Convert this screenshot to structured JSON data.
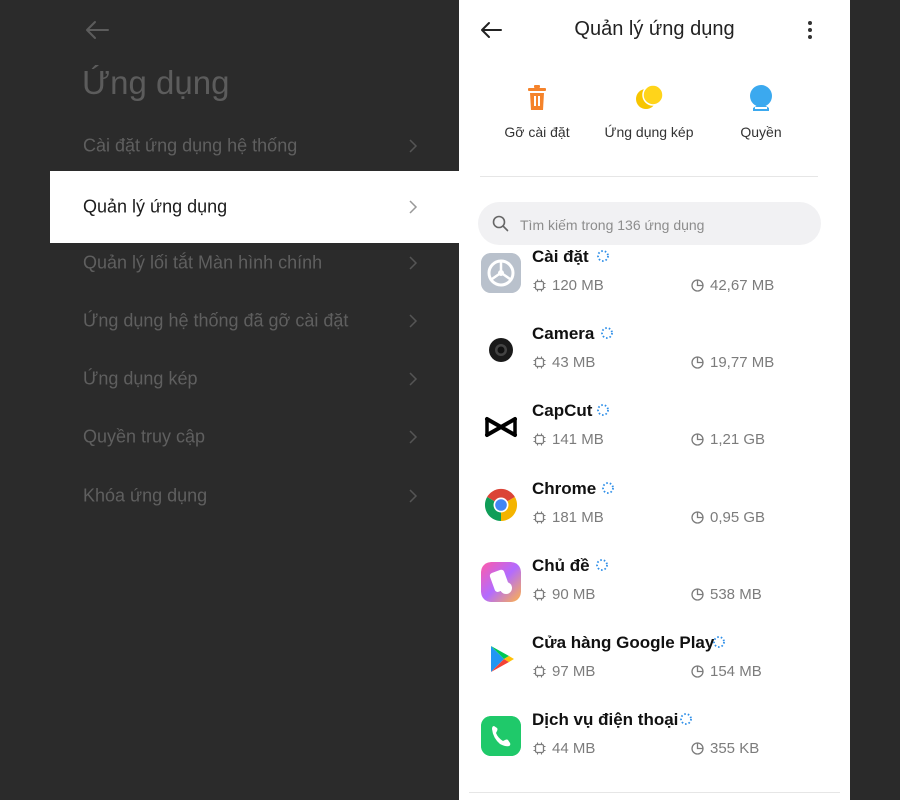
{
  "left": {
    "title": "Ứng dụng",
    "items": [
      {
        "label": "Cài đặt ứng dụng hệ thống"
      },
      {
        "label": "Quản lý ứng dụng"
      },
      {
        "label": "Quản lý lối tắt Màn hình chính"
      },
      {
        "label": "Ứng dụng hệ thống đã gỡ cài đặt"
      },
      {
        "label": "Ứng dụng kép"
      },
      {
        "label": "Quyền truy cập"
      },
      {
        "label": "Khóa ứng dụng"
      }
    ]
  },
  "right": {
    "title": "Quản lý ứng dụng",
    "quick_actions": [
      {
        "label": "Gỡ cài đặt",
        "icon": "trash-icon",
        "color": "#F5832B"
      },
      {
        "label": "Ứng dụng kép",
        "icon": "dual-circles-icon",
        "color": "#F7C500"
      },
      {
        "label": "Quyền",
        "icon": "permission-icon",
        "color": "#3BA9EF"
      }
    ],
    "search": {
      "placeholder": "Tìm kiếm trong 136 ứng dụng"
    },
    "apps": [
      {
        "name": "Cài đặt",
        "memory": "120 MB",
        "storage": "42,67 MB",
        "icon": "settings-app-icon"
      },
      {
        "name": "Camera",
        "memory": "43 MB",
        "storage": "19,77 MB",
        "icon": "camera-app-icon"
      },
      {
        "name": "CapCut",
        "memory": "141 MB",
        "storage": "1,21 GB",
        "icon": "capcut-app-icon"
      },
      {
        "name": "Chrome",
        "memory": "181 MB",
        "storage": "0,95 GB",
        "icon": "chrome-app-icon"
      },
      {
        "name": "Chủ đề",
        "memory": "90 MB",
        "storage": "538 MB",
        "icon": "themes-app-icon"
      },
      {
        "name": "Cửa hàng Google Play",
        "memory": "97 MB",
        "storage": "154 MB",
        "icon": "play-store-app-icon"
      },
      {
        "name": "Dịch vụ điện thoại",
        "memory": "44 MB",
        "storage": "355 KB",
        "icon": "phone-services-app-icon"
      }
    ]
  }
}
